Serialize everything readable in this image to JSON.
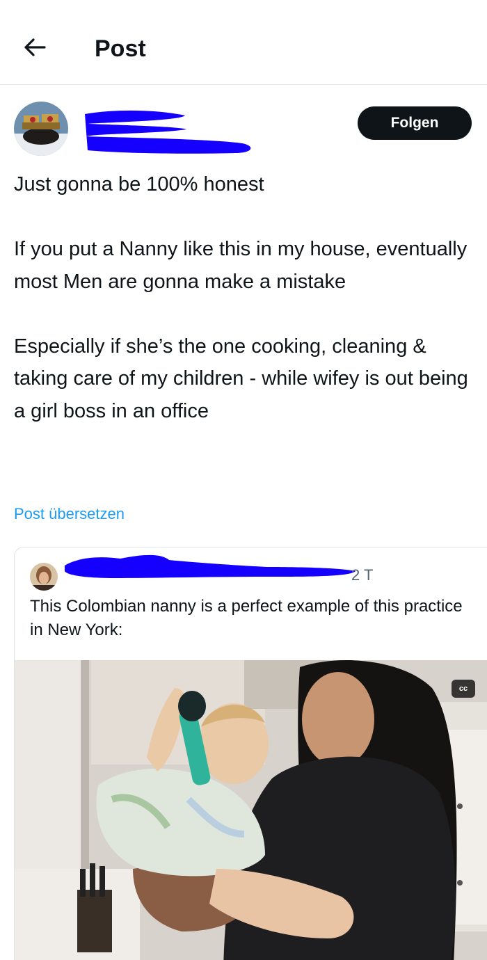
{
  "header": {
    "title": "Post",
    "back_icon": "arrow-left-icon"
  },
  "post": {
    "follow_label": "Folgen",
    "paragraphs": [
      "Just gonna be 100% honest",
      "If you put a Nanny like this in my house, eventually most Men are gonna make a mistake",
      "Especially if she’s the one cooking, cleaning & taking care of my children - while wifey is out being a girl boss in an office"
    ],
    "translate_label": "Post übersetzen"
  },
  "quote": {
    "time": "2 T",
    "text": "This Colombian nanny is a perfect example of this practice in New York:",
    "cc_label": "cc"
  },
  "colors": {
    "link": "#1d9bf0",
    "redaction": "#1500ff",
    "button_bg": "#0f1419",
    "border": "#e6e9ec"
  }
}
